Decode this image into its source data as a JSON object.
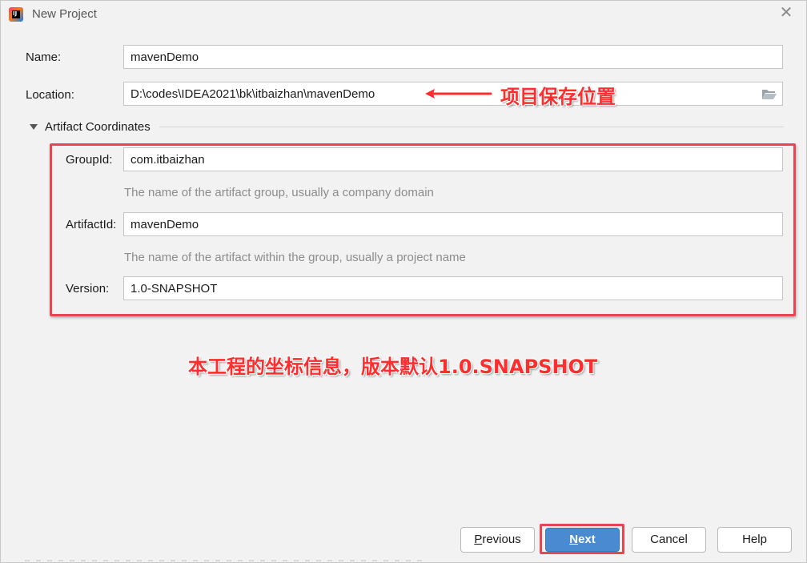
{
  "window": {
    "title": "New Project"
  },
  "form": {
    "name_label": "Name:",
    "name_value": "mavenDemo",
    "location_label": "Location:",
    "location_value": "D:\\codes\\IDEA2021\\bk\\itbaizhan\\mavenDemo"
  },
  "artifact": {
    "section_label": "Artifact Coordinates",
    "groupid_label": "GroupId:",
    "groupid_value": "com.itbaizhan",
    "groupid_hint": "The name of the artifact group, usually a company domain",
    "artifactid_label": "ArtifactId:",
    "artifactid_value": "mavenDemo",
    "artifactid_hint": "The name of the artifact within the group, usually a project name",
    "version_label": "Version:",
    "version_value": "1.0-SNAPSHOT"
  },
  "annotations": {
    "location_note": "项目保存位置",
    "coords_note": "本工程的坐标信息，版本默认1.0.SNAPSHOT"
  },
  "buttons": {
    "previous_prefix": "",
    "previous_mnemonic": "P",
    "previous_rest": "revious",
    "next_mnemonic": "N",
    "next_rest": "ext",
    "cancel": "Cancel",
    "help": "Help"
  },
  "colors": {
    "annotation_red": "#e8454f",
    "primary_button": "#4a8ad1",
    "background": "#f2f2f2"
  },
  "icons": [
    "intellij-idea-icon",
    "close-icon",
    "folder-open-icon",
    "collapse-triangle-icon",
    "arrow-left-icon"
  ]
}
